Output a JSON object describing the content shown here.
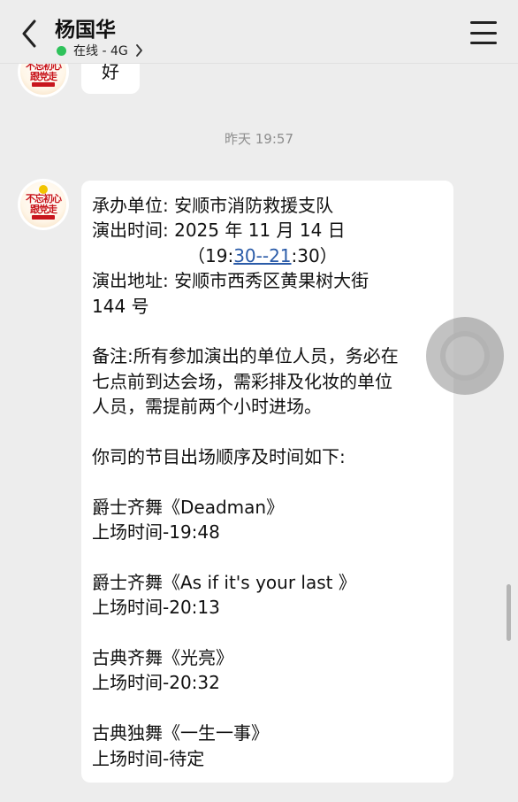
{
  "header": {
    "contact_name": "杨国华",
    "status_text": "在线 - 4G",
    "status_color": "#2fc25b"
  },
  "messages": {
    "prev_reply": "好",
    "timestamp": "昨天 19:57",
    "main": {
      "line1": "承办单位: 安顺市消防救援支队",
      "line2": "演出时间: 2025 年 11 月 14 日",
      "time_prefix": "（19:",
      "time_link": "30--21",
      "time_suffix": ":30）",
      "line4": "演出地址: 安顺市西秀区黄果树大街",
      "line5": "144 号",
      "note1": "备注:所有参加演出的单位人员，务必在",
      "note2": "七点前到达会场，需彩排及化妆的单位",
      "note3": "人员，需提前两个小时进场。",
      "intro": "你司的节目出场顺序及时间如下:",
      "programs": [
        {
          "name": "爵士齐舞《Deadman》",
          "time": "上场时间-19:48"
        },
        {
          "name": "爵士齐舞《As if it's your last 》",
          "time": "上场时间-20:13"
        },
        {
          "name": "古典齐舞《光亮》",
          "time": "上场时间-20:32"
        },
        {
          "name": "古典独舞《一生一事》",
          "time": "上场时间-待定"
        }
      ]
    }
  },
  "avatar": {
    "logo_text_line1": "不忘初心",
    "logo_text_line2": "跟党走"
  },
  "colors": {
    "background": "#ededed",
    "bubble": "#ffffff",
    "link": "#2a5ba8",
    "accent_red": "#c8161d"
  }
}
